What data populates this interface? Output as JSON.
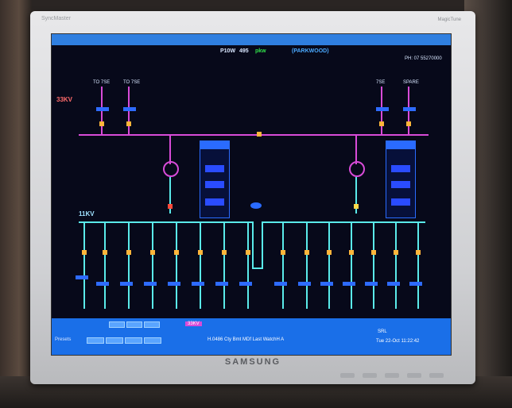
{
  "monitor": {
    "bezel_brand": "SyncMaster",
    "brand": "SAMSUNG",
    "bezel_logo": "MagicTune"
  },
  "scada": {
    "title": "P10W",
    "title_code": "495",
    "title_unit": "pkw",
    "station": "(PARKWOOD)",
    "header_right": "PH: 07 55270000",
    "voltage_hv": "33KV",
    "voltage_lv": "11KV",
    "feeders_left": [
      "TO 7SE",
      "TO 7SE"
    ],
    "feeders_right": [
      "7SE",
      "SPARE"
    ],
    "status_bar": "33KV",
    "alarm_text": "H.0486 Cty Bmt MDf Last WatchH A",
    "footer_left": "Presets",
    "footer_right_top": "SRL",
    "footer_right_date": "Tue 22-Oct 11:22:42"
  }
}
